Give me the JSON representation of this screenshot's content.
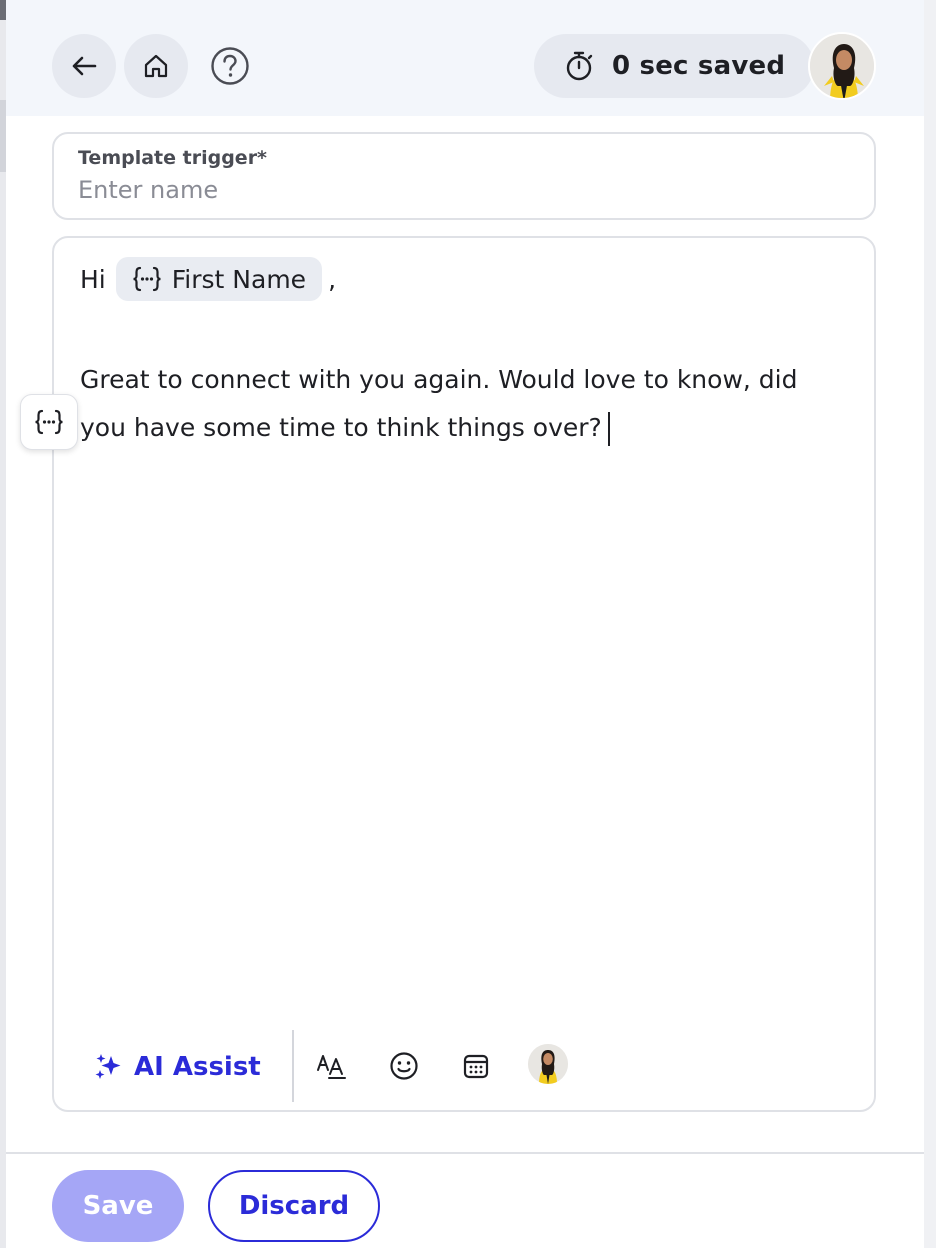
{
  "header": {
    "time_saved": "0 sec saved"
  },
  "trigger": {
    "label": "Template trigger*",
    "placeholder": "Enter name",
    "value": ""
  },
  "editor": {
    "greeting": "Hi",
    "variable_chip": "First Name",
    "after_chip": ",",
    "body": "Great to connect with you again. Would love to know, did you have some time to think things over?"
  },
  "toolbar": {
    "ai_assist_label": "AI Assist",
    "icons": [
      "text-format-icon",
      "emoji-icon",
      "calendar-icon",
      "avatar"
    ]
  },
  "footer": {
    "save_label": "Save",
    "discard_label": "Discard"
  },
  "colors": {
    "accent": "#2b2bd8",
    "save_disabled": "#a5a6f6",
    "header_bg": "#f3f6fb",
    "chip_bg": "#e9ecf2"
  }
}
